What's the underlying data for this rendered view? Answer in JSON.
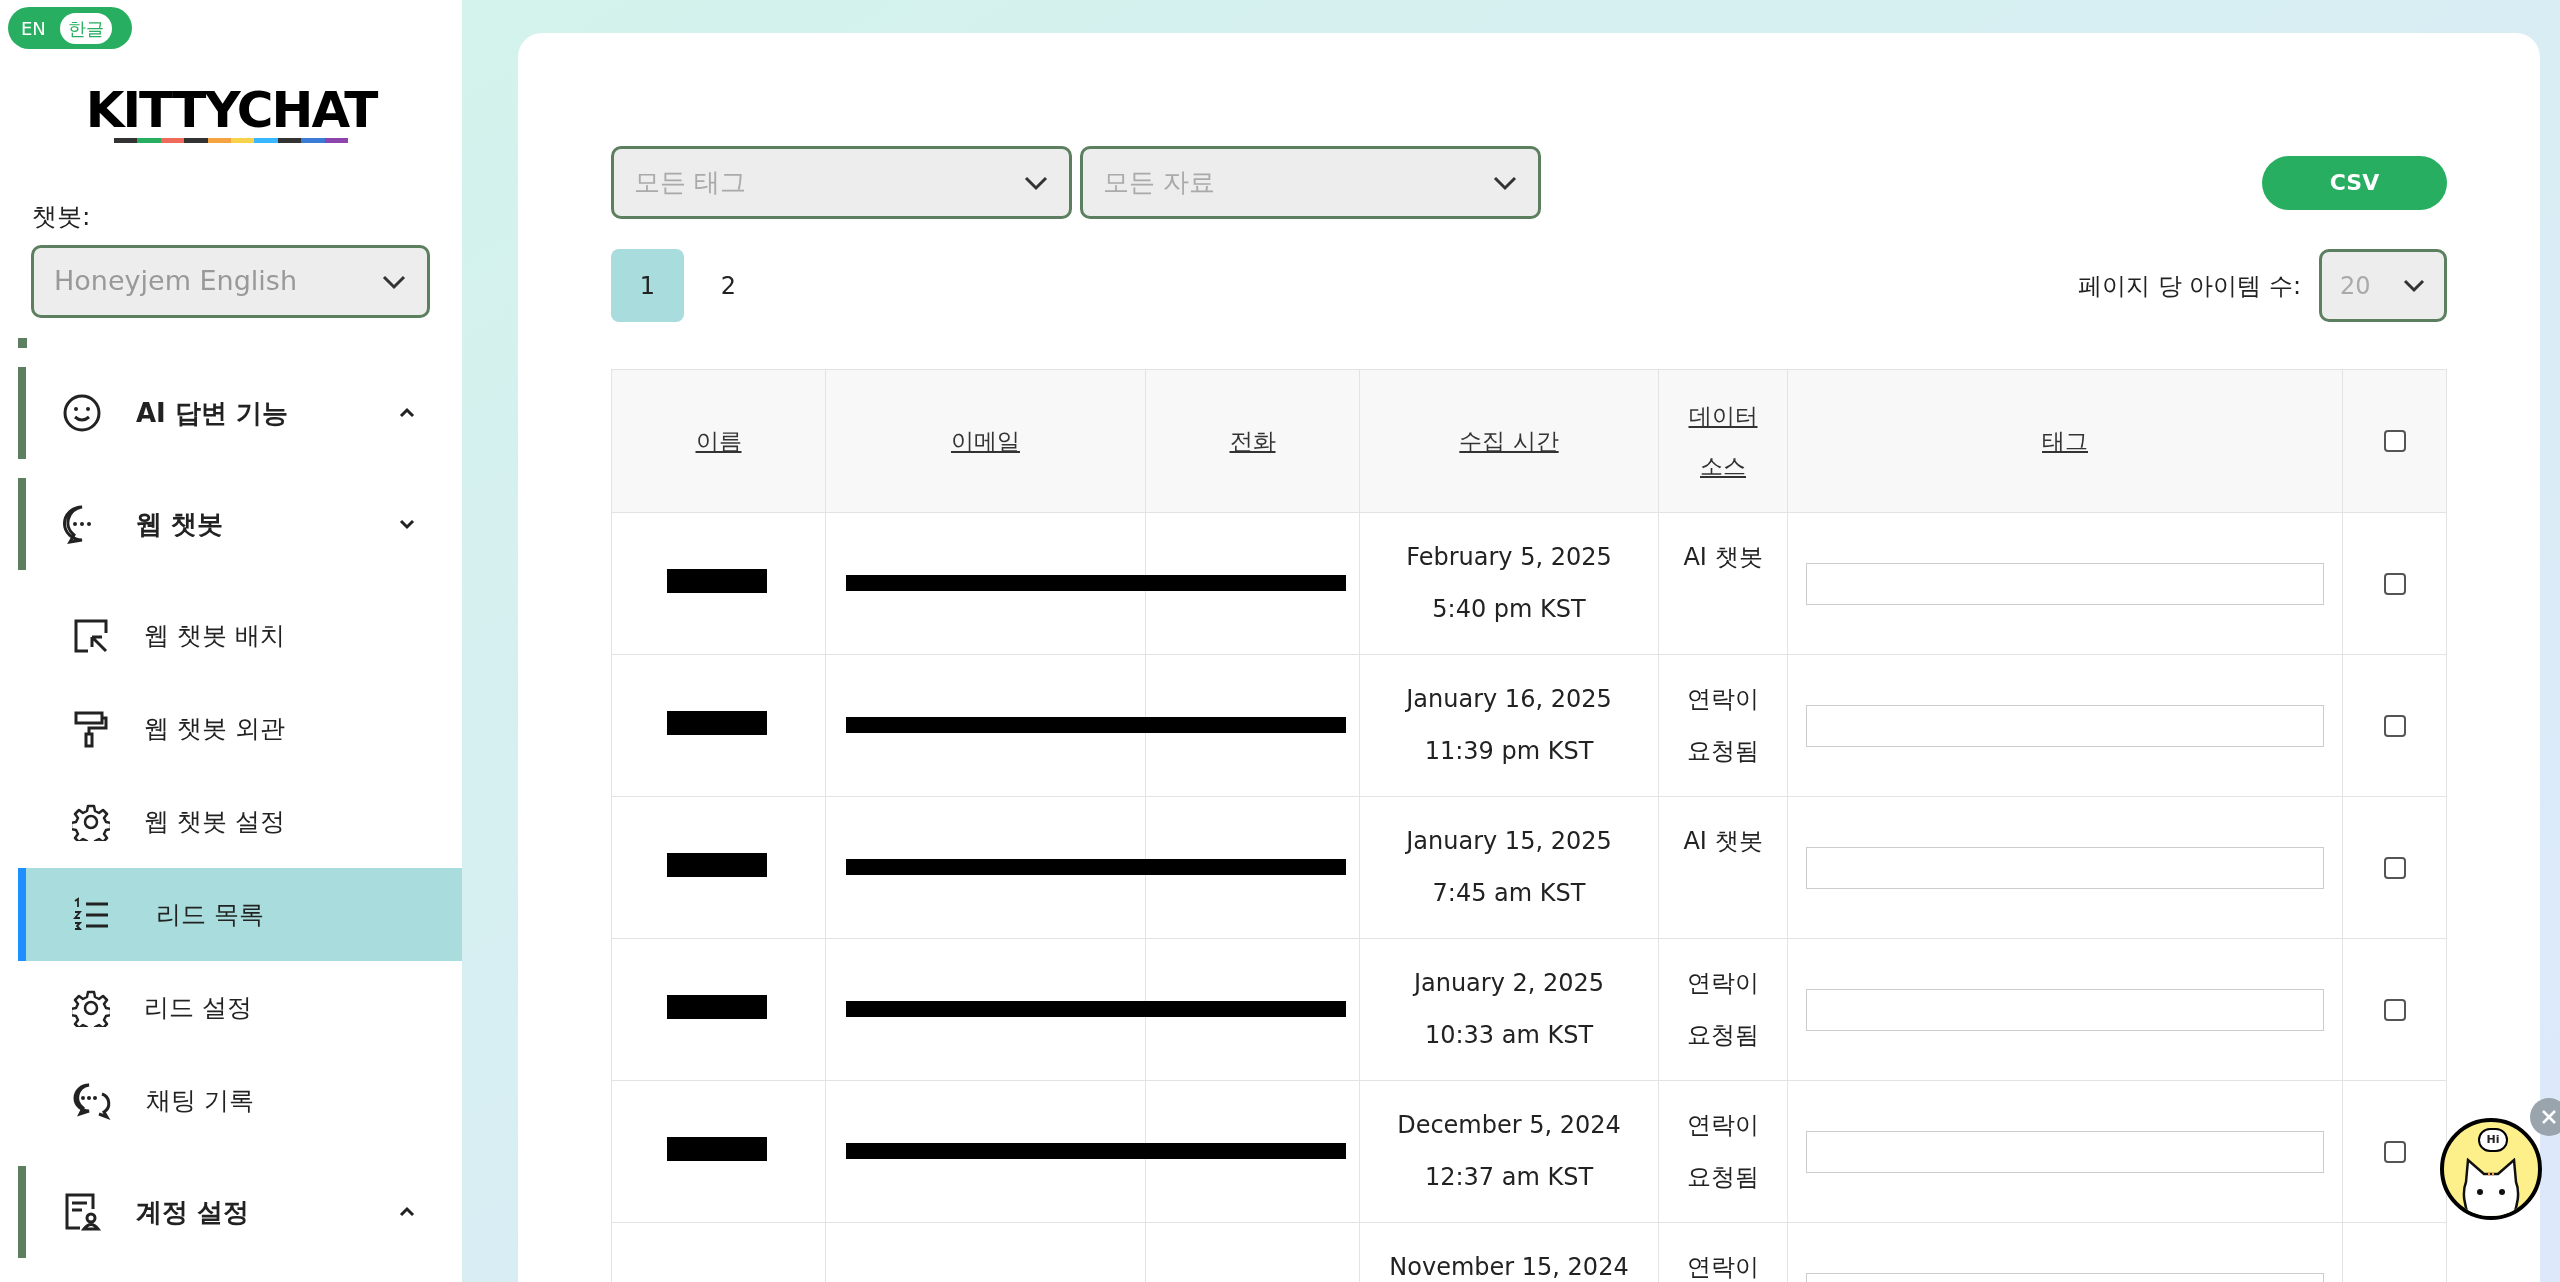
{
  "language_toggle": [
    {
      "label": "EN",
      "selected": false
    },
    {
      "label": "한글",
      "selected": true
    }
  ],
  "logo": "KITTYCHAT",
  "chatbot_label": "챗봇:",
  "chatbot_select": {
    "value": "Honeyjem English"
  },
  "menu": [
    {
      "label": "AI 답변 기능",
      "expanded": false
    },
    {
      "label": "웹 챗봇",
      "expanded": true,
      "children": [
        {
          "label": "웹 챗봇 배치",
          "selected": false
        },
        {
          "label": "웹 챗봇 외관",
          "selected": false
        },
        {
          "label": "웹 챗봇 설정",
          "selected": false
        },
        {
          "label": "리드 목록",
          "selected": true
        },
        {
          "label": "리드 설정",
          "selected": false
        },
        {
          "label": "채팅 기록",
          "selected": false
        }
      ]
    },
    {
      "label": "계정 설정",
      "expanded": false
    }
  ],
  "filters": [
    {
      "placeholder": "모든 태그"
    },
    {
      "placeholder": "모든 자료"
    }
  ],
  "csv_button": "CSV",
  "pages": [
    {
      "label": "1",
      "selected": true
    },
    {
      "label": "2",
      "selected": false
    }
  ],
  "items_per_page": {
    "label": "페이지 당 아이템 수:",
    "value": "20"
  },
  "table": {
    "select_all_checked": false,
    "columns": [
      "이름",
      "이메일",
      "전화",
      "수집 시간",
      "데이터 소스",
      "태그"
    ],
    "rows": [
      {
        "redacted": true,
        "time": [
          "February 5, 2025",
          "5:40 pm KST"
        ],
        "source": [
          "AI 챗봇"
        ],
        "checked": false
      },
      {
        "redacted": true,
        "time": [
          "January 16, 2025",
          "11:39 pm KST"
        ],
        "source": [
          "연락이",
          "요청됨"
        ],
        "checked": false
      },
      {
        "redacted": true,
        "time": [
          "January 15, 2025",
          "7:45 am KST"
        ],
        "source": [
          "AI 챗봇"
        ],
        "checked": false
      },
      {
        "redacted": true,
        "time": [
          "January 2, 2025",
          "10:33 am KST"
        ],
        "source": [
          "연락이",
          "요청됨"
        ],
        "checked": false
      },
      {
        "redacted": true,
        "time": [
          "December 5, 2024",
          "12:37 am KST"
        ],
        "source": [
          "연락이",
          "요청됨"
        ],
        "checked": false
      },
      {
        "time": [
          "November 15, 2024"
        ],
        "source": [
          "연락이"
        ]
      }
    ]
  },
  "chat_launcher": {
    "bubble": "Hi"
  }
}
